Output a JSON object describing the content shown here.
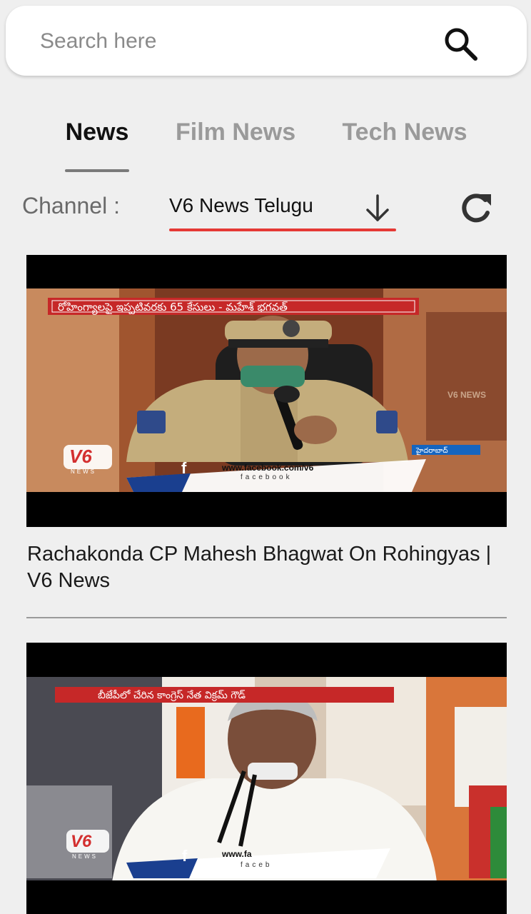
{
  "search": {
    "placeholder": "Search here"
  },
  "tabs": [
    {
      "label": "News",
      "active": true
    },
    {
      "label": "Film News",
      "active": false
    },
    {
      "label": "Tech News",
      "active": false
    }
  ],
  "channel": {
    "label": "Channel :",
    "selected": "V6 News Telugu"
  },
  "colors": {
    "accent": "#e53935",
    "background": "#efefef",
    "card_bg": "#ffffff"
  },
  "icons": [
    "search-icon",
    "arrow-down-icon",
    "refresh-icon"
  ],
  "videos": [
    {
      "title": "Rachakonda CP Mahesh Bhagwat On Rohingyas | V6 News",
      "overlay": {
        "banner": "రోహింగ్యాలపై ఇప్పటివరకు 65 కేసులు - మహేశ్ భగవత్",
        "logo": "V6",
        "logo_sub": "NEWS",
        "social_url": "www.facebook.com/v6",
        "social_name": "facebook",
        "location": "హైదరాబాద్",
        "watermark": "V6 NEWS"
      }
    },
    {
      "title": "",
      "overlay": {
        "banner": "బీజేపీలో చేరిన కాంగ్రెస్ నేత విక్రమ్ గౌడ్",
        "logo": "V6",
        "logo_sub": "NEWS",
        "social_url": "www.fa",
        "social_name": "faceb"
      }
    }
  ]
}
